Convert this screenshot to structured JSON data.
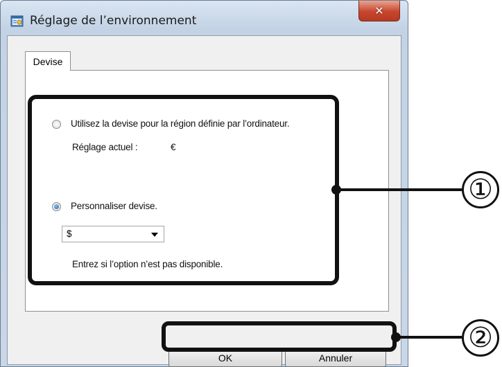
{
  "window": {
    "title": "Réglage de l’environnement",
    "close_glyph": "✕"
  },
  "tabs": [
    {
      "label": "Devise",
      "active": true
    }
  ],
  "currency": {
    "option_system": {
      "label": "Utilisez la devise pour la région définie par l’ordinateur.",
      "checked": false
    },
    "current_label": "Réglage actuel :",
    "current_value": "€",
    "option_custom": {
      "label": "Personnaliser devise.",
      "checked": true
    },
    "custom_value": "$",
    "hint": "Entrez si l’option n’est pas disponible."
  },
  "buttons": {
    "ok": "OK",
    "cancel": "Annuler"
  },
  "callouts": {
    "one": "①",
    "two": "②"
  },
  "icons": {
    "app": "settings-window-icon",
    "close": "close-icon",
    "dropdown": "chevron-down-icon"
  }
}
